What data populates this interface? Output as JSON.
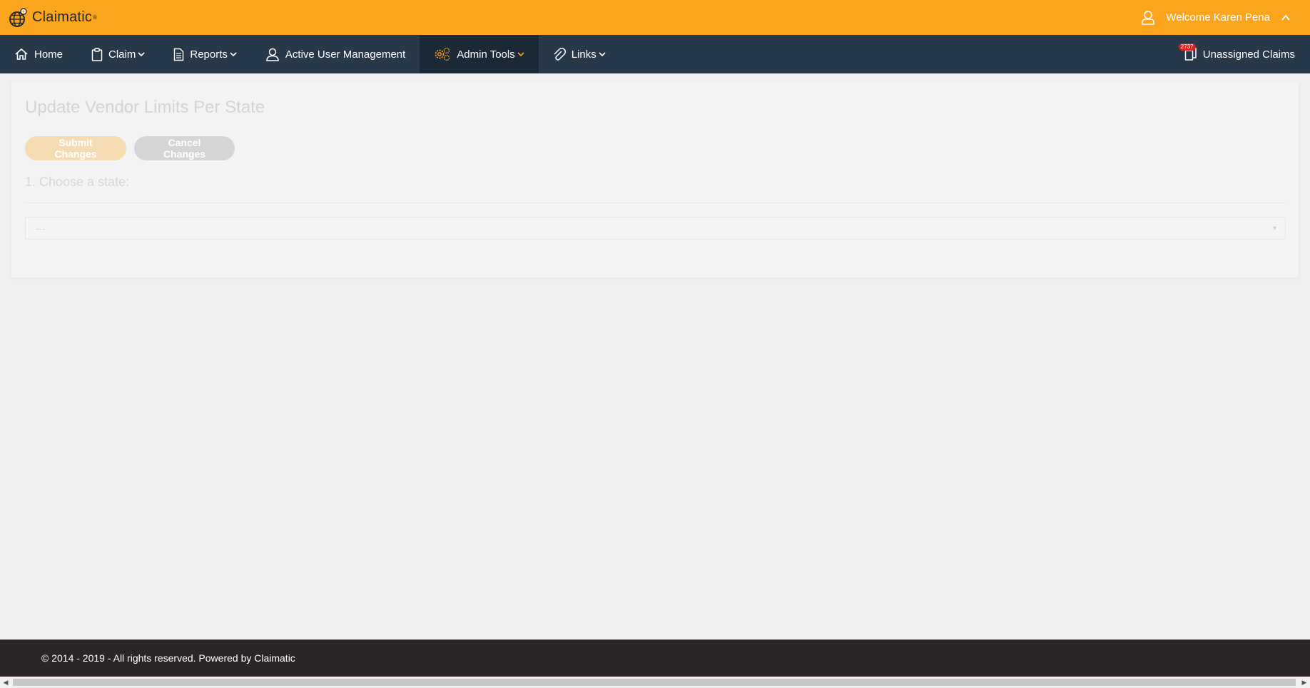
{
  "brand": {
    "name": "Claimatic",
    "tm": "®"
  },
  "user": {
    "welcome": "Welcome Karen Pena"
  },
  "nav": {
    "home": "Home",
    "claim": "Claim",
    "reports": "Reports",
    "active_user_management": "Active User Management",
    "admin_tools": "Admin Tools",
    "links": "Links",
    "unassigned_claims": "Unassigned Claims",
    "unassigned_count": "2737"
  },
  "page": {
    "title": "Update Vendor Limits Per State",
    "submit_label": "Submit Changes",
    "cancel_label": "Cancel Changes",
    "step_label": "1. Choose a state:",
    "state_select_value": "---"
  },
  "footer": {
    "text": "© 2014 - 2019 - All rights reserved. Powered by Claimatic"
  },
  "colors": {
    "brand_orange": "#fba51f",
    "nav_bg": "#27384a",
    "nav_active_bg": "#1b2836",
    "footer_bg": "#2b2625",
    "badge_red": "#e02020"
  },
  "icons": {
    "home": "home-icon",
    "claim": "clipboard-icon",
    "reports": "document-icon",
    "users": "user-icon",
    "admin": "gears-icon",
    "links": "paperclip-icon",
    "unassigned": "copy-icon"
  }
}
